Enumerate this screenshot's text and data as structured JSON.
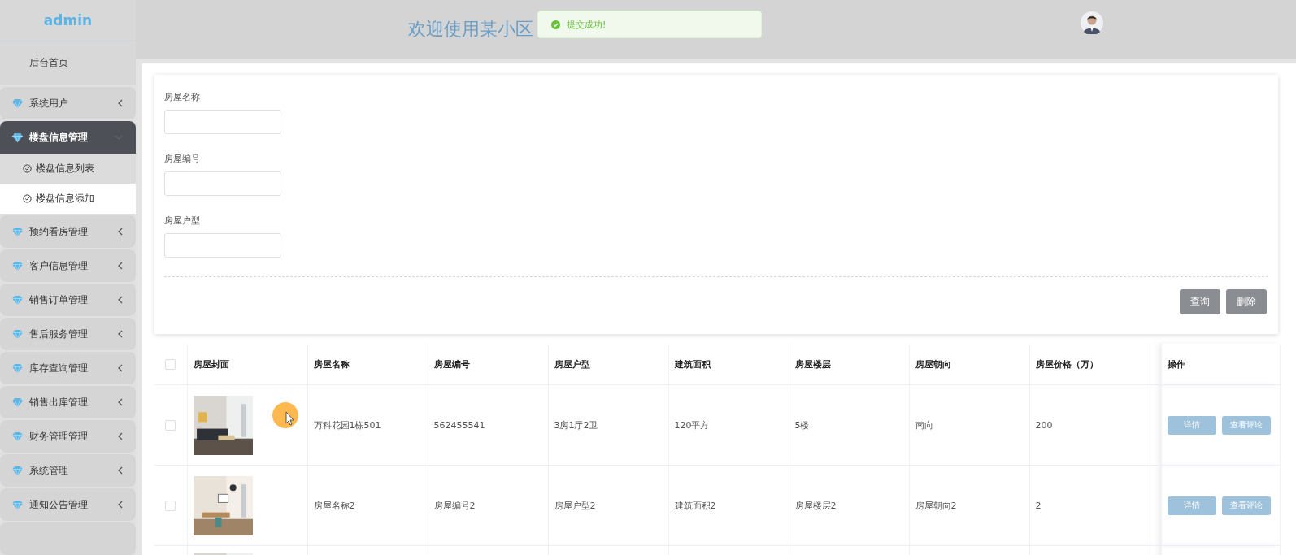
{
  "sidebar": {
    "brand": "admin",
    "home": "后台首页",
    "items": [
      {
        "label": "系统用户",
        "expanded": false
      },
      {
        "label": "楼盘信息管理",
        "expanded": true,
        "children": [
          {
            "label": "楼盘信息列表",
            "selected": false
          },
          {
            "label": "楼盘信息添加",
            "selected": true
          }
        ]
      },
      {
        "label": "预约看房管理",
        "expanded": false
      },
      {
        "label": "客户信息管理",
        "expanded": false
      },
      {
        "label": "销售订单管理",
        "expanded": false
      },
      {
        "label": "售后服务管理",
        "expanded": false
      },
      {
        "label": "库存查询管理",
        "expanded": false
      },
      {
        "label": "销售出库管理",
        "expanded": false
      },
      {
        "label": "财务管理管理",
        "expanded": false
      },
      {
        "label": "系统管理",
        "expanded": false
      },
      {
        "label": "通知公告管理",
        "expanded": false
      }
    ]
  },
  "header": {
    "title": "欢迎使用某小区",
    "toast": "提交成功!"
  },
  "search": {
    "fields": [
      {
        "label": "房屋名称"
      },
      {
        "label": "房屋编号"
      },
      {
        "label": "房屋户型"
      }
    ],
    "buttons": [
      "查询",
      "删除"
    ]
  },
  "table": {
    "columns": [
      "房屋封面",
      "房屋名称",
      "房屋编号",
      "房屋户型",
      "建筑面积",
      "房屋楼层",
      "房屋朝向",
      "房屋价格（万）"
    ],
    "actions_header": "操作",
    "all_checked": false,
    "rows": [
      {
        "checked": false,
        "cover": {
          "kind": "picture"
        },
        "cells": [
          "万科花园1栋501",
          "562455541",
          "3房1厅2卫",
          "120平方",
          "5楼",
          "南向",
          "200"
        ],
        "actions": [
          "详情",
          "查看评论"
        ]
      },
      {
        "checked": false,
        "cover": {
          "kind": "picture"
        },
        "cells": [
          "房屋名称2",
          "房屋编号2",
          "房屋户型2",
          "建筑面积2",
          "房屋楼层2",
          "房屋朝向2",
          "2"
        ],
        "actions": [
          "详情",
          "查看评论"
        ]
      },
      {
        "cover": {
          "kind": "picture"
        }
      }
    ]
  }
}
